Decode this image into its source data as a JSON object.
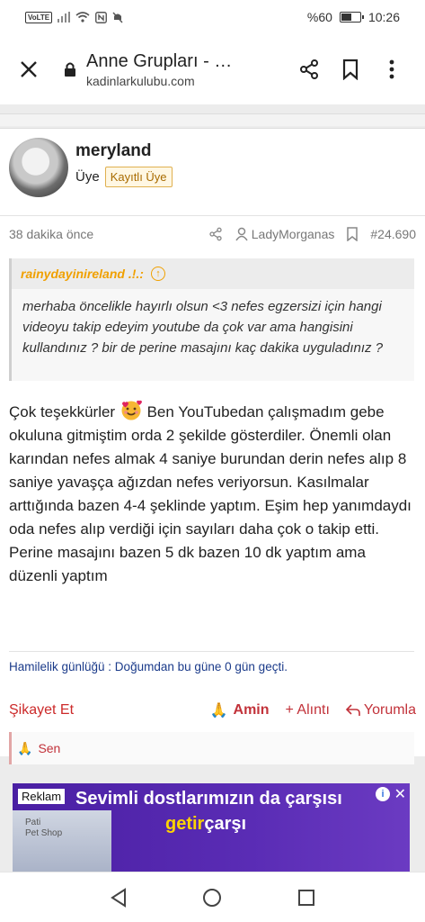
{
  "status_bar": {
    "network": "VoLTE",
    "battery_text": "%60",
    "battery_level": 0.6,
    "time": "10:26"
  },
  "url_bar": {
    "page_title": "Anne Grupları - …",
    "domain": "kadinlarkulubu.com",
    "close_icon": "close-icon",
    "share_icon": "share-icon",
    "bookmark_icon": "bookmark-icon",
    "menu_icon": "more-vert-icon"
  },
  "post": {
    "username": "meryland",
    "role": "Üye",
    "badge": "Kayıtlı Üye",
    "time_ago": "38 dakika önce",
    "mentioned_user": "LadyMorganas",
    "post_number": "#24.690",
    "quote": {
      "author": "rainydayinireland .!.:",
      "text": "merhaba öncelikle hayırlı olsun <3 nefes egzersizi için hangi videoyu takip edeyim youtube da çok var ama hangisini kullandınız ? bir de perine masajını kaç dakika uyguladınız ?"
    },
    "body_start": "Çok teşekkürler",
    "body_rest": " Ben YouTubedan çalışmadım gebe okuluna gitmiştim orda 2 şekilde gösterdiler. Önemli olan karından nefes almak 4 saniye burundan derin nefes alıp 8 saniye yavaşça ağızdan nefes veriyorsun. Kasılmalar arttığında bazen 4-4 şeklinde yaptım. Eşim hep yanımdaydı oda nefes alıp verdiği için sayıları daha çok o takip etti. Perine masajını bazen 5 dk bazen 10 dk yaptım ama düzenli yaptım",
    "signature": "Hamilelik günlüğü : Doğumdan bu güne 0 gün geçti.",
    "actions": {
      "report": "Şikayet Et",
      "amin": "Amin",
      "quote": "+ Alıntı",
      "reply": "Yorumla"
    },
    "reaction_users": "Sen"
  },
  "ad": {
    "label": "Reklam",
    "headline": "Sevimli dostlarımızın da çarşısı",
    "brand_part1": "getir",
    "brand_part2": "çarşı",
    "image_text": "Pati\nPet Shop",
    "colors": {
      "background": "#4a1fa3",
      "brand": "#ffd300"
    }
  },
  "nav": {
    "back_icon": "back-triangle-icon",
    "home_icon": "home-circle-icon",
    "recents_icon": "recents-square-icon"
  },
  "colors": {
    "accent_red": "#c2323a",
    "badge_orange": "#a86b00",
    "quote_author": "#f0a000",
    "signature_blue": "#1b3b8a"
  }
}
